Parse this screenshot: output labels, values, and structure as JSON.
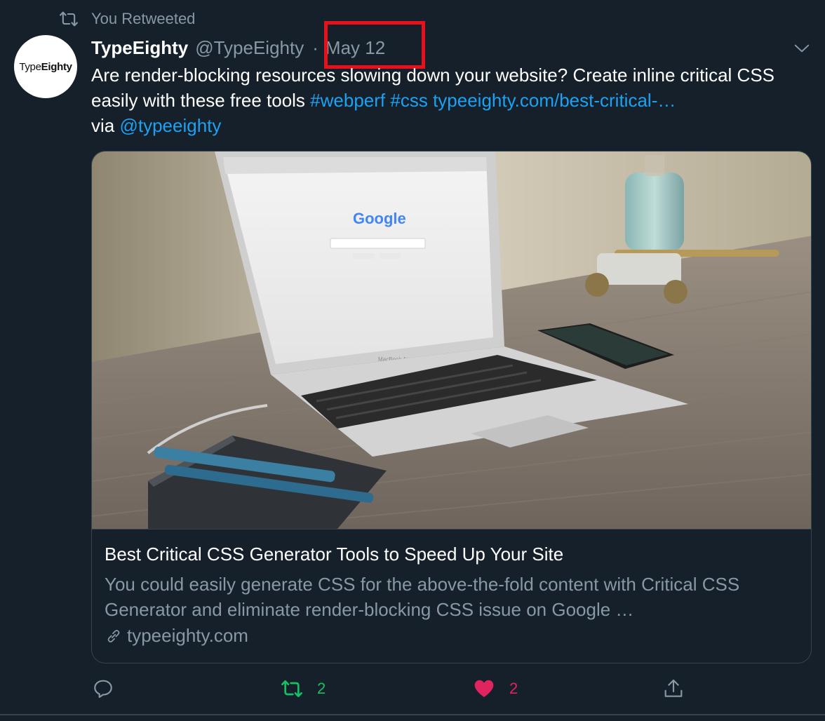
{
  "retweet_bar": {
    "label": "You Retweeted",
    "icon": "retweet-icon"
  },
  "author": {
    "avatar_text_plain": "Type",
    "avatar_text_bold": "Eighty",
    "display_name": "TypeEighty",
    "handle": "@TypeEighty",
    "separator": "·",
    "date": "May 12"
  },
  "tweet": {
    "text_part1": "Are render-blocking resources slowing down your website? Create inline critical CSS easily with these free tools ",
    "hashtag1": "#webperf",
    "hashtag2": "#css",
    "url": "typeeighty.com/best-critical-…",
    "via": "via ",
    "mention": "@typeeighty"
  },
  "card": {
    "title": "Best Critical CSS Generator Tools to Speed Up Your Site",
    "description": "You could easily generate CSS for the above-the-fold content with Critical CSS Generator and eliminate render-blocking CSS issue on Google …",
    "domain": "typeeighty.com",
    "image": {
      "search_logo": "Google",
      "laptop_brand": "MacBook Air"
    }
  },
  "actions": {
    "reply": {
      "icon": "reply-icon",
      "count": ""
    },
    "retweet": {
      "icon": "retweet-icon",
      "count": "2",
      "active": true,
      "color": "#17bf63"
    },
    "like": {
      "icon": "heart-icon",
      "count": "2",
      "active": true,
      "color": "#e0245e"
    },
    "share": {
      "icon": "share-icon"
    }
  },
  "colors": {
    "background": "#15202b",
    "text": "#ffffff",
    "secondary": "#8899a6",
    "link": "#1da1f2",
    "border": "#38444d",
    "highlight": "#e8111b"
  }
}
